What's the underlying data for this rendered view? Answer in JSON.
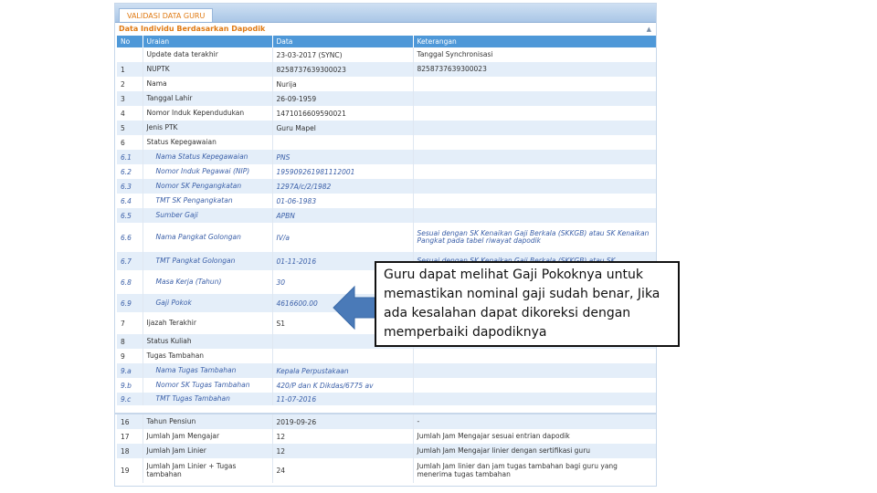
{
  "tab_label": "VALIDASI DATA GURU",
  "section_title": "Data Individu Berdasarkan Dapodik",
  "collapse_glyph": "▲",
  "headers": [
    "No",
    "Uraian",
    "Data",
    "Keterangan"
  ],
  "rows": [
    {
      "no": "",
      "uraian": "Update data terakhir",
      "data": "23-03-2017 (SYNC)",
      "ket": "Tanggal Synchronisasi"
    },
    {
      "no": "1",
      "uraian": "NUPTK",
      "data": "8258737639300023",
      "ket": "8258737639300023"
    },
    {
      "no": "2",
      "uraian": "Nama",
      "data": "Nurija",
      "ket": ""
    },
    {
      "no": "3",
      "uraian": "Tanggal Lahir",
      "data": "26-09-1959",
      "ket": ""
    },
    {
      "no": "4",
      "uraian": "Nomor Induk Kependudukan",
      "data": "1471016609590021",
      "ket": ""
    },
    {
      "no": "5",
      "uraian": "Jenis PTK",
      "data": "Guru Mapel",
      "ket": ""
    },
    {
      "no": "6",
      "uraian": "Status Kepegawaian",
      "data": "",
      "ket": ""
    },
    {
      "no": "6.1",
      "uraian": "Nama Status Kepegawaian",
      "data": "PNS",
      "ket": ""
    },
    {
      "no": "6.2",
      "uraian": "Nomor Induk Pegawai (NIP)",
      "data": "195909261981112001",
      "ket": ""
    },
    {
      "no": "6.3",
      "uraian": "Nomor SK Pengangkatan",
      "data": "1297A/c/2/1982",
      "ket": ""
    },
    {
      "no": "6.4",
      "uraian": "TMT SK Pengangkatan",
      "data": "01-06-1983",
      "ket": ""
    },
    {
      "no": "6.5",
      "uraian": "Sumber Gaji",
      "data": "APBN",
      "ket": ""
    },
    {
      "no": "6.6",
      "uraian": "Nama Pangkat Golongan",
      "data": "IV/a",
      "ket": "Sesuai dengan SK Kenaikan Gaji Berkala (SKKGB) atau SK Kenaikan Pangkat pada tabel riwayat dapodik"
    },
    {
      "no": "6.7",
      "uraian": "TMT Pangkat Golongan",
      "data": "01-11-2016",
      "ket": "Sesuai dengan SK Kenaikan Gaji Berkala (SKKGB) atau SK"
    },
    {
      "no": "6.8",
      "uraian": "Masa Kerja (Tahun)",
      "data": "30",
      "ket": ""
    },
    {
      "no": "6.9",
      "uraian": "Gaji Pokok",
      "data": "4616600.00",
      "ket": ""
    },
    {
      "no": "7",
      "uraian": "Ijazah Terakhir",
      "data": "S1",
      "ket": ""
    },
    {
      "no": "8",
      "uraian": "Status Kuliah",
      "data": "",
      "ket": ""
    },
    {
      "no": "9",
      "uraian": "Tugas Tambahan",
      "data": "",
      "ket": ""
    },
    {
      "no": "9.a",
      "uraian": "Nama Tugas Tambahan",
      "data": "Kepala Perpustakaan",
      "ket": ""
    },
    {
      "no": "9.b",
      "uraian": "Nomor SK Tugas Tambahan",
      "data": "420/P dan K Dikdas/6775 av",
      "ket": ""
    },
    {
      "no": "9.c",
      "uraian": "TMT Tugas Tambahan",
      "data": "11-07-2016",
      "ket": ""
    }
  ],
  "rows2": [
    {
      "no": "16",
      "uraian": "Tahun Pensiun",
      "data": "2019-09-26",
      "ket": "-"
    },
    {
      "no": "17",
      "uraian": "Jumlah Jam Mengajar",
      "data": "12",
      "ket": "Jumlah Jam Mengajar sesuai entrian dapodik"
    },
    {
      "no": "18",
      "uraian": "Jumlah Jam Linier",
      "data": "12",
      "ket": "Jumlah Jam Mengajar linier dengan sertifikasi guru"
    },
    {
      "no": "19",
      "uraian": "Jumlah Jam Linier + Tugas tambahan",
      "data": "24",
      "ket": "Jumlah Jam linier dan jam tugas tambahan bagi guru yang menerima tugas tambahan"
    }
  ],
  "callout_text": "Guru dapat melihat Gaji Pokoknya untuk memastikan nominal gaji sudah benar, Jika ada kesalahan dapat dikoreksi dengan memperbaiki dapodiknya",
  "colors": {
    "header_blue": "#4e98d8",
    "accent_orange": "#e07a13",
    "row_alt": "#e4eef9",
    "arrow": "#4a7ab8"
  }
}
